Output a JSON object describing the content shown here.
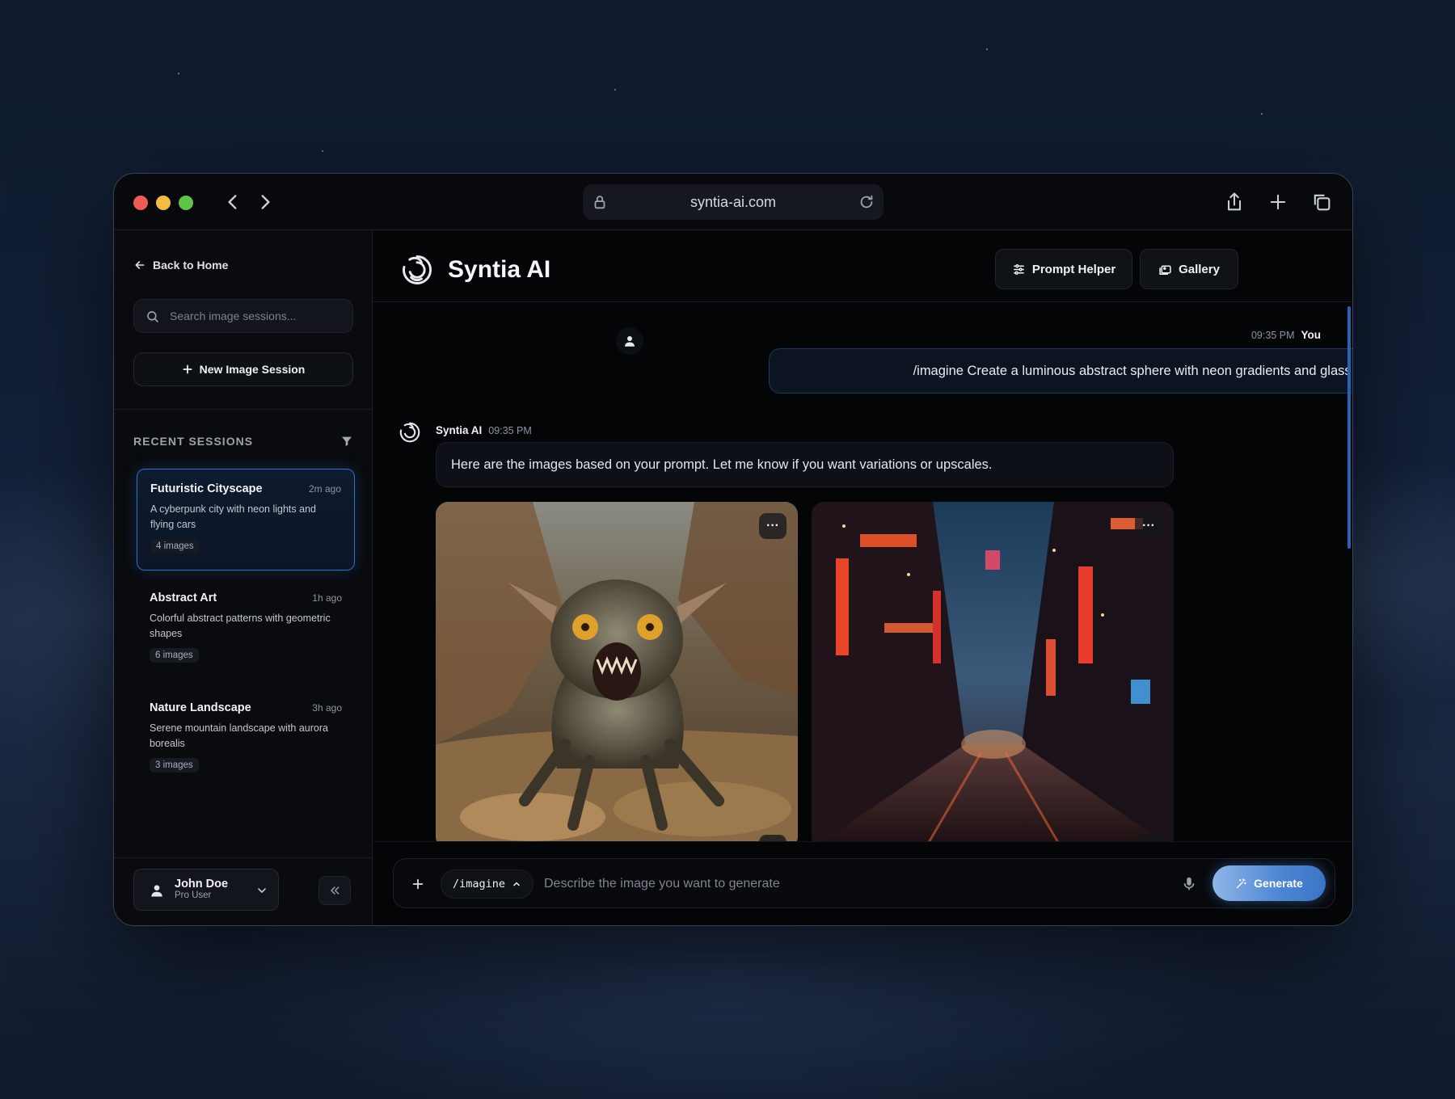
{
  "browser": {
    "url": "syntia-ai.com"
  },
  "sidebar": {
    "back_label": "Back to Home",
    "search_placeholder": "Search image sessions...",
    "new_session_label": "New Image Session",
    "recent_title": "RECENT SESSIONS",
    "sessions": [
      {
        "name": "Futuristic Cityscape",
        "time": "2m ago",
        "desc": "A cyberpunk city with neon lights and flying cars",
        "count": "4 images",
        "active": true
      },
      {
        "name": "Abstract Art",
        "time": "1h ago",
        "desc": "Colorful abstract patterns with geometric shapes",
        "count": "6 images",
        "active": false
      },
      {
        "name": "Nature Landscape",
        "time": "3h ago",
        "desc": "Serene mountain landscape with aurora borealis",
        "count": "3 images",
        "active": false
      }
    ],
    "user": {
      "name": "John Doe",
      "role": "Pro User"
    }
  },
  "header": {
    "brand": "Syntia AI",
    "prompt_helper_label": "Prompt Helper",
    "gallery_label": "Gallery"
  },
  "chat": {
    "user_message": {
      "time": "09:35 PM",
      "author": "You",
      "text": "/imagine Create a luminous abstract sphere with neon gradients and glass reflections."
    },
    "ai_message": {
      "author": "Syntia AI",
      "time": "09:35 PM",
      "text": "Here are the images based on your prompt. Let me know if you want variations or upscales."
    },
    "images": [
      {
        "subject": "alien creature in desert canyon",
        "menu": "···",
        "add": "+"
      },
      {
        "subject": "neon cyberpunk street at night",
        "menu": "···",
        "add": "+"
      }
    ]
  },
  "composer": {
    "command": "/imagine",
    "placeholder": "Describe the image you want to generate",
    "generate_label": "Generate"
  },
  "colors": {
    "accent": "#3a74c4",
    "active_session_border": "#2f6fc4"
  }
}
